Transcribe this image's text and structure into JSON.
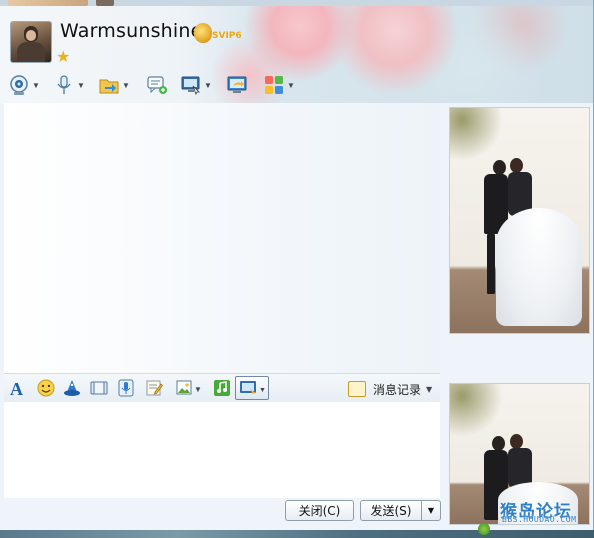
{
  "header": {
    "username": "Warmsunshine",
    "vip_badge": "SVIP6"
  },
  "toolbar": {
    "icons": [
      "video-call-icon",
      "voice-call-icon",
      "send-file-icon",
      "group-chat-icon",
      "remote-assist-icon",
      "share-screen-icon",
      "apps-icon"
    ]
  },
  "format_bar": {
    "icons": [
      "font-icon",
      "emoji-icon",
      "magic-expression-icon",
      "screenshot-frame-icon",
      "voice-message-icon",
      "note-icon",
      "image-icon",
      "music-icon",
      "screen-capture-icon"
    ],
    "history_label": "消息记录"
  },
  "buttons": {
    "close_label": "关闭(C)",
    "send_label": "发送(S)"
  },
  "watermark": {
    "line1": "猴岛论坛",
    "line2": "BBS.HOUDAO.COM"
  },
  "colors": {
    "accent": "#2f7fc4",
    "window_bg": "#eef4f9"
  }
}
